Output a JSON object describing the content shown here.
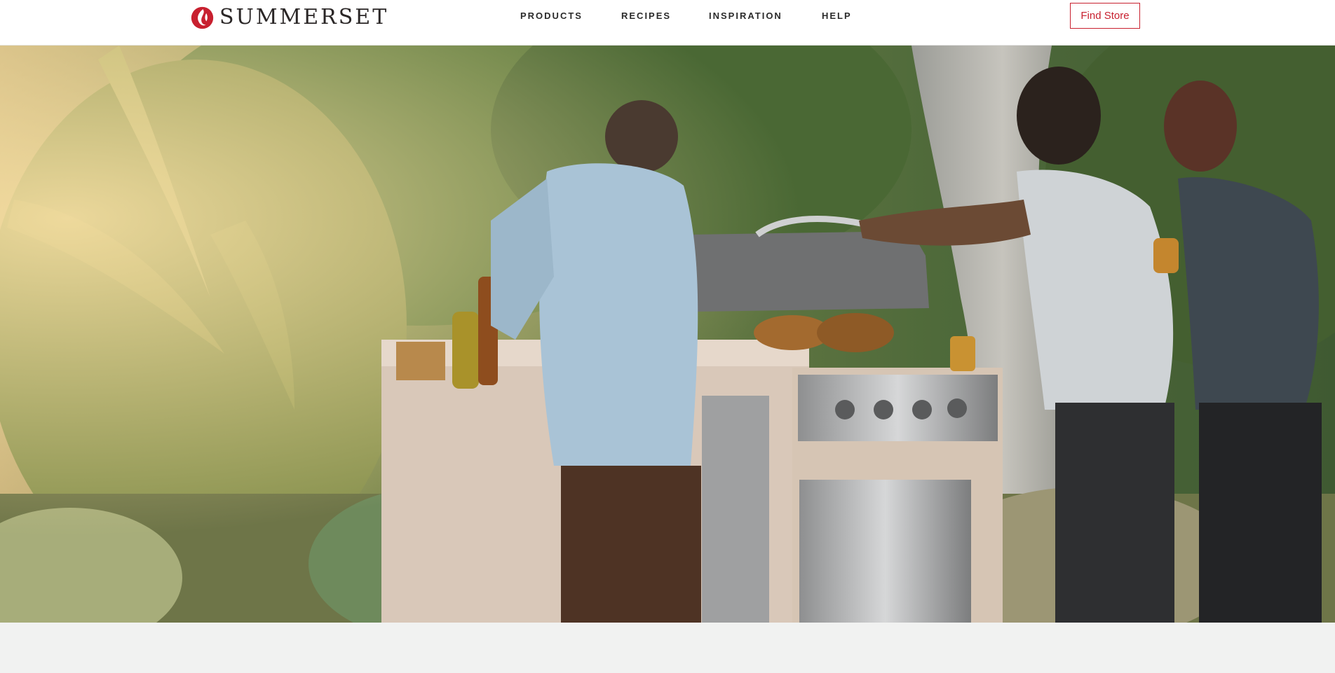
{
  "brand": {
    "name": "SUMMERSET",
    "logo_icon": "flame-logo-icon",
    "accent_color": "#c8202f"
  },
  "nav": {
    "items": [
      {
        "label": "PRODUCTS"
      },
      {
        "label": "RECIPES"
      },
      {
        "label": "INSPIRATION"
      },
      {
        "label": "HELP"
      }
    ]
  },
  "header": {
    "find_store_label": "Find Store"
  },
  "hero": {
    "image_subject": "hero-photo"
  }
}
